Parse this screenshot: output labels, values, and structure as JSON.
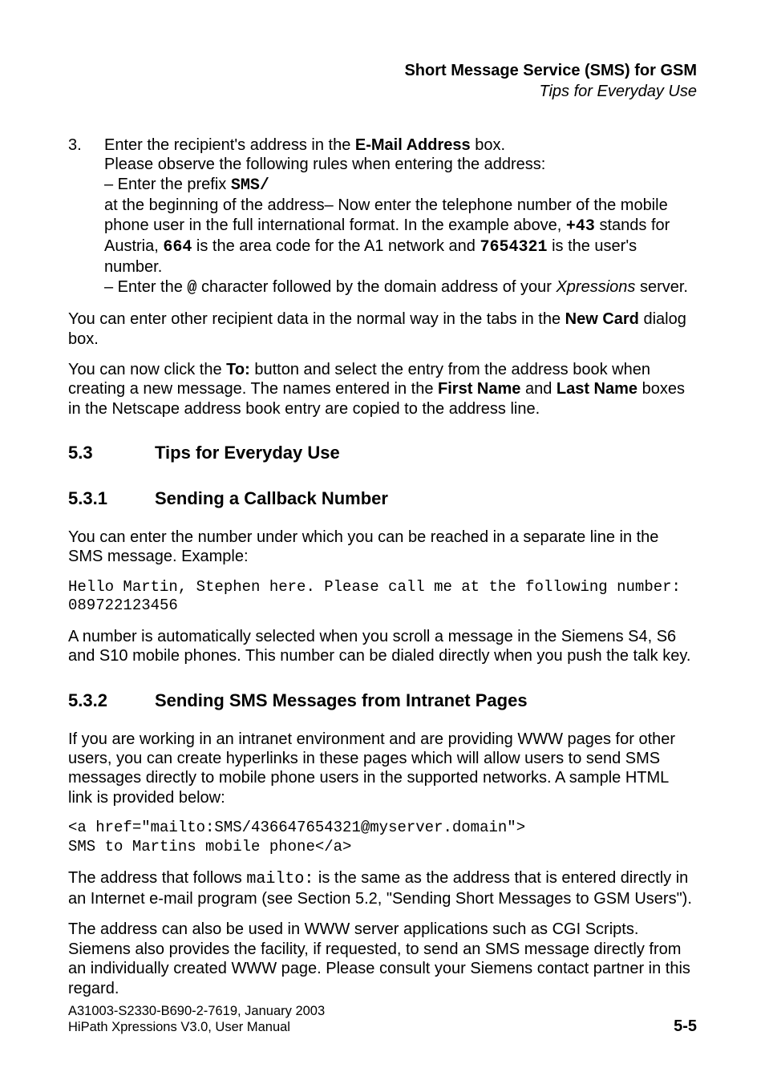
{
  "header": {
    "title": "Short Message Service (SMS) for GSM",
    "subtitle": "Tips for Everyday Use"
  },
  "step3": {
    "num": "3.",
    "line1a": "Enter the recipient's address in the ",
    "line1b": "E-Mail Address",
    "line1c": " box.",
    "line2": "Please observe the following rules when entering the address:",
    "line3a": "– Enter the prefix ",
    "line3b": "SMS/",
    "line4a": " at the beginning of the address– Now enter the telephone number of the mobile phone user in the full international format. In the example above, ",
    "line4b": "+43",
    "line4c": " stands for Austria, ",
    "line4d": "664",
    "line4e": " is the area code for the A1 network and ",
    "line4f": "7654321",
    "line4g": " is the user's number.",
    "line5a": "– Enter the ",
    "line5b": "@",
    "line5c": " character followed by the domain address of your ",
    "line5d": "Xpressions",
    "line5e": " server."
  },
  "para1": {
    "a": "You can enter other recipient data in the normal way in the tabs in the ",
    "b": "New Card",
    "c": " dialog box."
  },
  "para2": {
    "a": "You can now click the ",
    "b": "To:",
    "c": " button and select the entry from the address book when creating a new message. The names entered in the ",
    "d": "First Name",
    "e": " and ",
    "f": "Last Name",
    "g": " boxes in the Netscape address book entry are copied to the address line."
  },
  "sec53": {
    "num": "5.3",
    "title": "Tips for Everyday Use"
  },
  "sec531": {
    "num": "5.3.1",
    "title": "Sending a Callback Number"
  },
  "p531a": "You can enter the number under which you can be reached in a separate line in the SMS message. Example:",
  "code1": "Hello Martin, Stephen here. Please call me at the following number:\n089722123456",
  "p531b": "A number is automatically selected when you scroll a message in the Siemens S4, S6 and S10 mobile phones. This number can be dialed directly when you push the talk key.",
  "sec532": {
    "num": "5.3.2",
    "title": "Sending SMS Messages from Intranet Pages"
  },
  "p532a": "If you are working in an intranet environment and are providing WWW pages for other users, you can create hyperlinks in these pages which will allow users to send SMS messages directly to mobile phone users in the supported networks. A sample HTML link is provided below:",
  "code2": "<a href=\"mailto:SMS/436647654321@myserver.domain\">\nSMS to Martins mobile phone</a>",
  "p532b": {
    "a": "The address that follows ",
    "b": "mailto:",
    "c": " is the same as the address that is entered directly in an Internet e-mail program (see Section 5.2, \"Sending Short Messages to GSM Users\")."
  },
  "p532c": "The address can also be used in WWW server applications such as CGI Scripts. Siemens also provides the facility, if requested, to send an SMS message directly from an individually created WWW page. Please consult your Siemens contact partner in this regard.",
  "footer": {
    "line1": "A31003-S2330-B690-2-7619, January 2003",
    "line2": "HiPath Xpressions V3.0, User Manual",
    "pagenum": "5-5"
  }
}
